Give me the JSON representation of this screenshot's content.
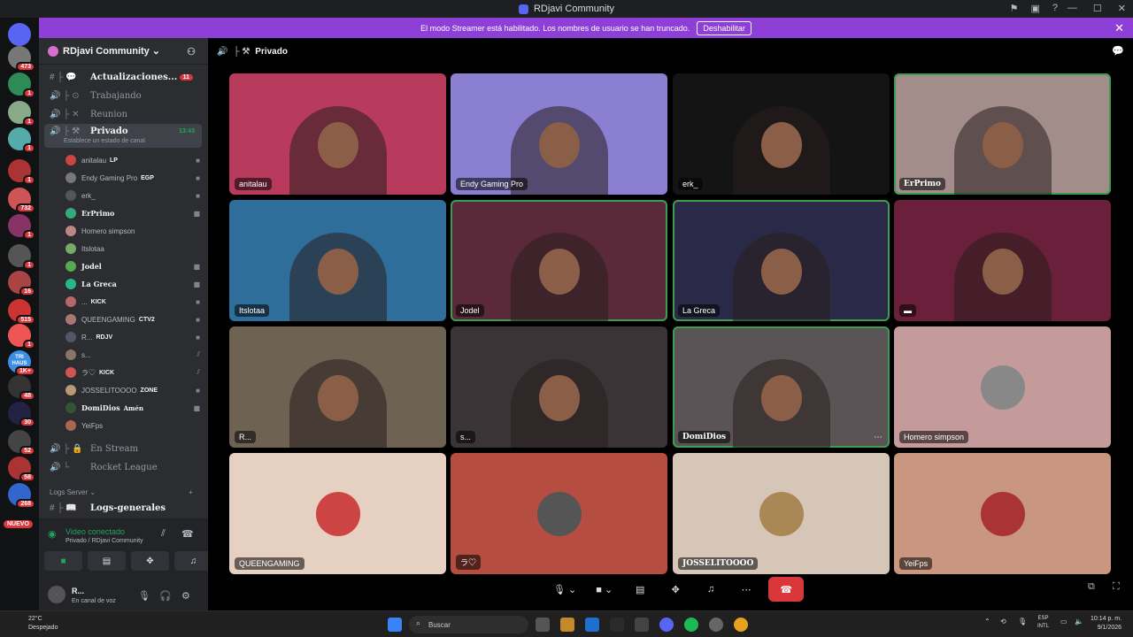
{
  "window": {
    "title": "RDjavi Community"
  },
  "banner": {
    "text": "El modo Streamer está habilitado. Los nombres de usuario se han truncado.",
    "button": "Deshabilitar"
  },
  "servers": {
    "badges": [
      "473",
      "1",
      "1",
      "1",
      "1",
      "732",
      "1",
      "1",
      "16",
      "515",
      "1",
      "1K+",
      "48",
      "30",
      "52",
      "58",
      "268"
    ],
    "nuevo": "NUEVO",
    "trihaus": "TRI HAUS"
  },
  "guild": {
    "name": "RDjavi Community"
  },
  "channels": [
    {
      "prefix": "# ├ 💬",
      "name": "Actualizaciones...",
      "count": "11"
    },
    {
      "prefix": "🔊 ├ ⊙",
      "name": "Trabajando"
    },
    {
      "prefix": "🔊 ├ ✕",
      "name": "Reunion"
    },
    {
      "prefix": "🔊 ├ ⚒",
      "name": "Privado",
      "time": "13:43",
      "sub": "Establece un estado de canal"
    }
  ],
  "users": [
    {
      "name": "anitalau",
      "tag": "LP"
    },
    {
      "name": "Endy Gaming Pro",
      "tag": "EGP"
    },
    {
      "name": "erk_",
      "tag": ""
    },
    {
      "name": "ErPrimo",
      "tag": ""
    },
    {
      "name": "Homero simpson",
      "tag": ""
    },
    {
      "name": "Itslotaa",
      "tag": ""
    },
    {
      "name": "Jodel",
      "tag": ""
    },
    {
      "name": "La Greca",
      "tag": ""
    },
    {
      "name": "...",
      "tag": "KICK"
    },
    {
      "name": "QUEENGAMING",
      "tag": "CTV2"
    },
    {
      "name": "R...",
      "tag": "RDJV"
    },
    {
      "name": "s...",
      "tag": ""
    },
    {
      "name": "ラ♡",
      "tag": "KICK"
    },
    {
      "name": "JOSSELITOOOO",
      "tag": "ZONE"
    },
    {
      "name": "DomiDios",
      "tag": "Amén"
    },
    {
      "name": "YeiFps",
      "tag": ""
    }
  ],
  "channels2": [
    {
      "prefix": "🔊 ├ 🔒",
      "name": "En Stream"
    },
    {
      "prefix": "🔊 └",
      "name": "Rocket League"
    }
  ],
  "category": {
    "name": "Logs Server"
  },
  "channel_logs": {
    "prefix": "# ├ 📖",
    "name": "Logs-generales"
  },
  "voice": {
    "status": "Video conectado",
    "location": "Privado / RDjavi Community"
  },
  "userbar": {
    "name": "R...",
    "status": "En canal de voz"
  },
  "main": {
    "channel": "Privado"
  },
  "tiles": [
    {
      "name": "anitalau",
      "bg": "#b83a5c"
    },
    {
      "name": "Endy Gaming Pro",
      "bg": "#8a7fd0"
    },
    {
      "name": "erk_",
      "bg": "#141414"
    },
    {
      "name": "ErPrimo",
      "bg": "#a28d8a"
    },
    {
      "name": "Itslotaa",
      "bg": "#2f6e9a"
    },
    {
      "name": "Jodel",
      "bg": "#5a2a3a"
    },
    {
      "name": "La Greca",
      "bg": "#2a2a48"
    },
    {
      "name": "",
      "bg": "#6a1f3a"
    },
    {
      "name": "R...",
      "bg": "#6e6252"
    },
    {
      "name": "s...",
      "bg": "#3a3436"
    },
    {
      "name": "DomiDios",
      "bg": "#5b5456"
    },
    {
      "name": "Homero simpson",
      "bg": "#c59a9a"
    },
    {
      "name": "QUEENGAMING",
      "bg": "#e6d0c2"
    },
    {
      "name": "ラ♡",
      "bg": "#b54e40"
    },
    {
      "name": "JOSSELITOOOO",
      "bg": "#d6c6b8"
    },
    {
      "name": "YeiFps",
      "bg": "#c9977f"
    }
  ],
  "taskbar": {
    "temp": "22°C",
    "weather": "Despejado",
    "search": "Buscar",
    "lang1": "ESP",
    "lang2": "INTL",
    "time": "10:14 p. m.",
    "date": "9/1/2026"
  },
  "colors": {
    "accent": "#5865f2",
    "banner": "#8e3fd8",
    "connected": "#23a559",
    "danger": "#da373c"
  }
}
